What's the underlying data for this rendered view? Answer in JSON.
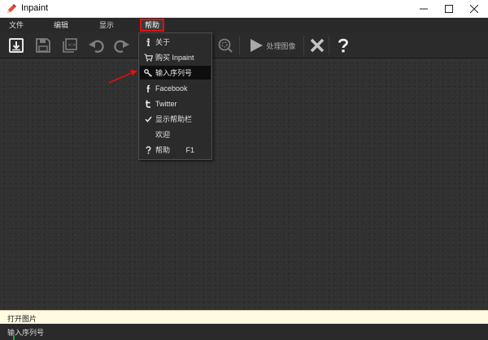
{
  "window": {
    "title": "Inpaint",
    "app_icon": "pencil-icon",
    "controls": {
      "minimize": "minimize-icon",
      "maximize": "maximize-icon",
      "close": "close-icon"
    }
  },
  "menubar": {
    "items": [
      {
        "label": "文件"
      },
      {
        "label": "编辑"
      },
      {
        "label": "显示"
      },
      {
        "label": "帮助",
        "highlighted": true,
        "highlight_color": "#e01010"
      }
    ]
  },
  "toolbar": {
    "buttons": [
      {
        "icon": "open-icon"
      },
      {
        "icon": "save-icon"
      },
      {
        "icon": "save-as-icon"
      },
      {
        "icon": "undo-icon"
      },
      {
        "icon": "redo-icon"
      },
      {
        "icon": "zoom-icon"
      },
      {
        "icon": "play-icon",
        "label": "处理图像"
      },
      {
        "icon": "cancel-icon"
      },
      {
        "icon": "help-icon"
      }
    ]
  },
  "help_menu": {
    "items": [
      {
        "icon": "info-icon",
        "label": "关于"
      },
      {
        "icon": "cart-icon",
        "label": "购买 Inpaint"
      },
      {
        "icon": "key-icon",
        "label": "输入序列号",
        "selected": true
      },
      {
        "icon": "facebook-icon",
        "label": "Facebook"
      },
      {
        "icon": "twitter-icon",
        "label": "Twitter"
      },
      {
        "icon": "check-icon",
        "label": "显示帮助栏",
        "checked": true
      },
      {
        "icon": "",
        "label": "欢迎"
      },
      {
        "icon": "question-icon",
        "label": "帮助",
        "shortcut": "F1"
      }
    ]
  },
  "hint_bar": {
    "text": "打开图片"
  },
  "status_bar": {
    "text": "输入序列号"
  },
  "colors": {
    "annotation_red": "#e01010",
    "canvas_bg": "#313131",
    "hint_bg": "#fffbe3",
    "toolbar_bg": "#2b2b2b"
  }
}
